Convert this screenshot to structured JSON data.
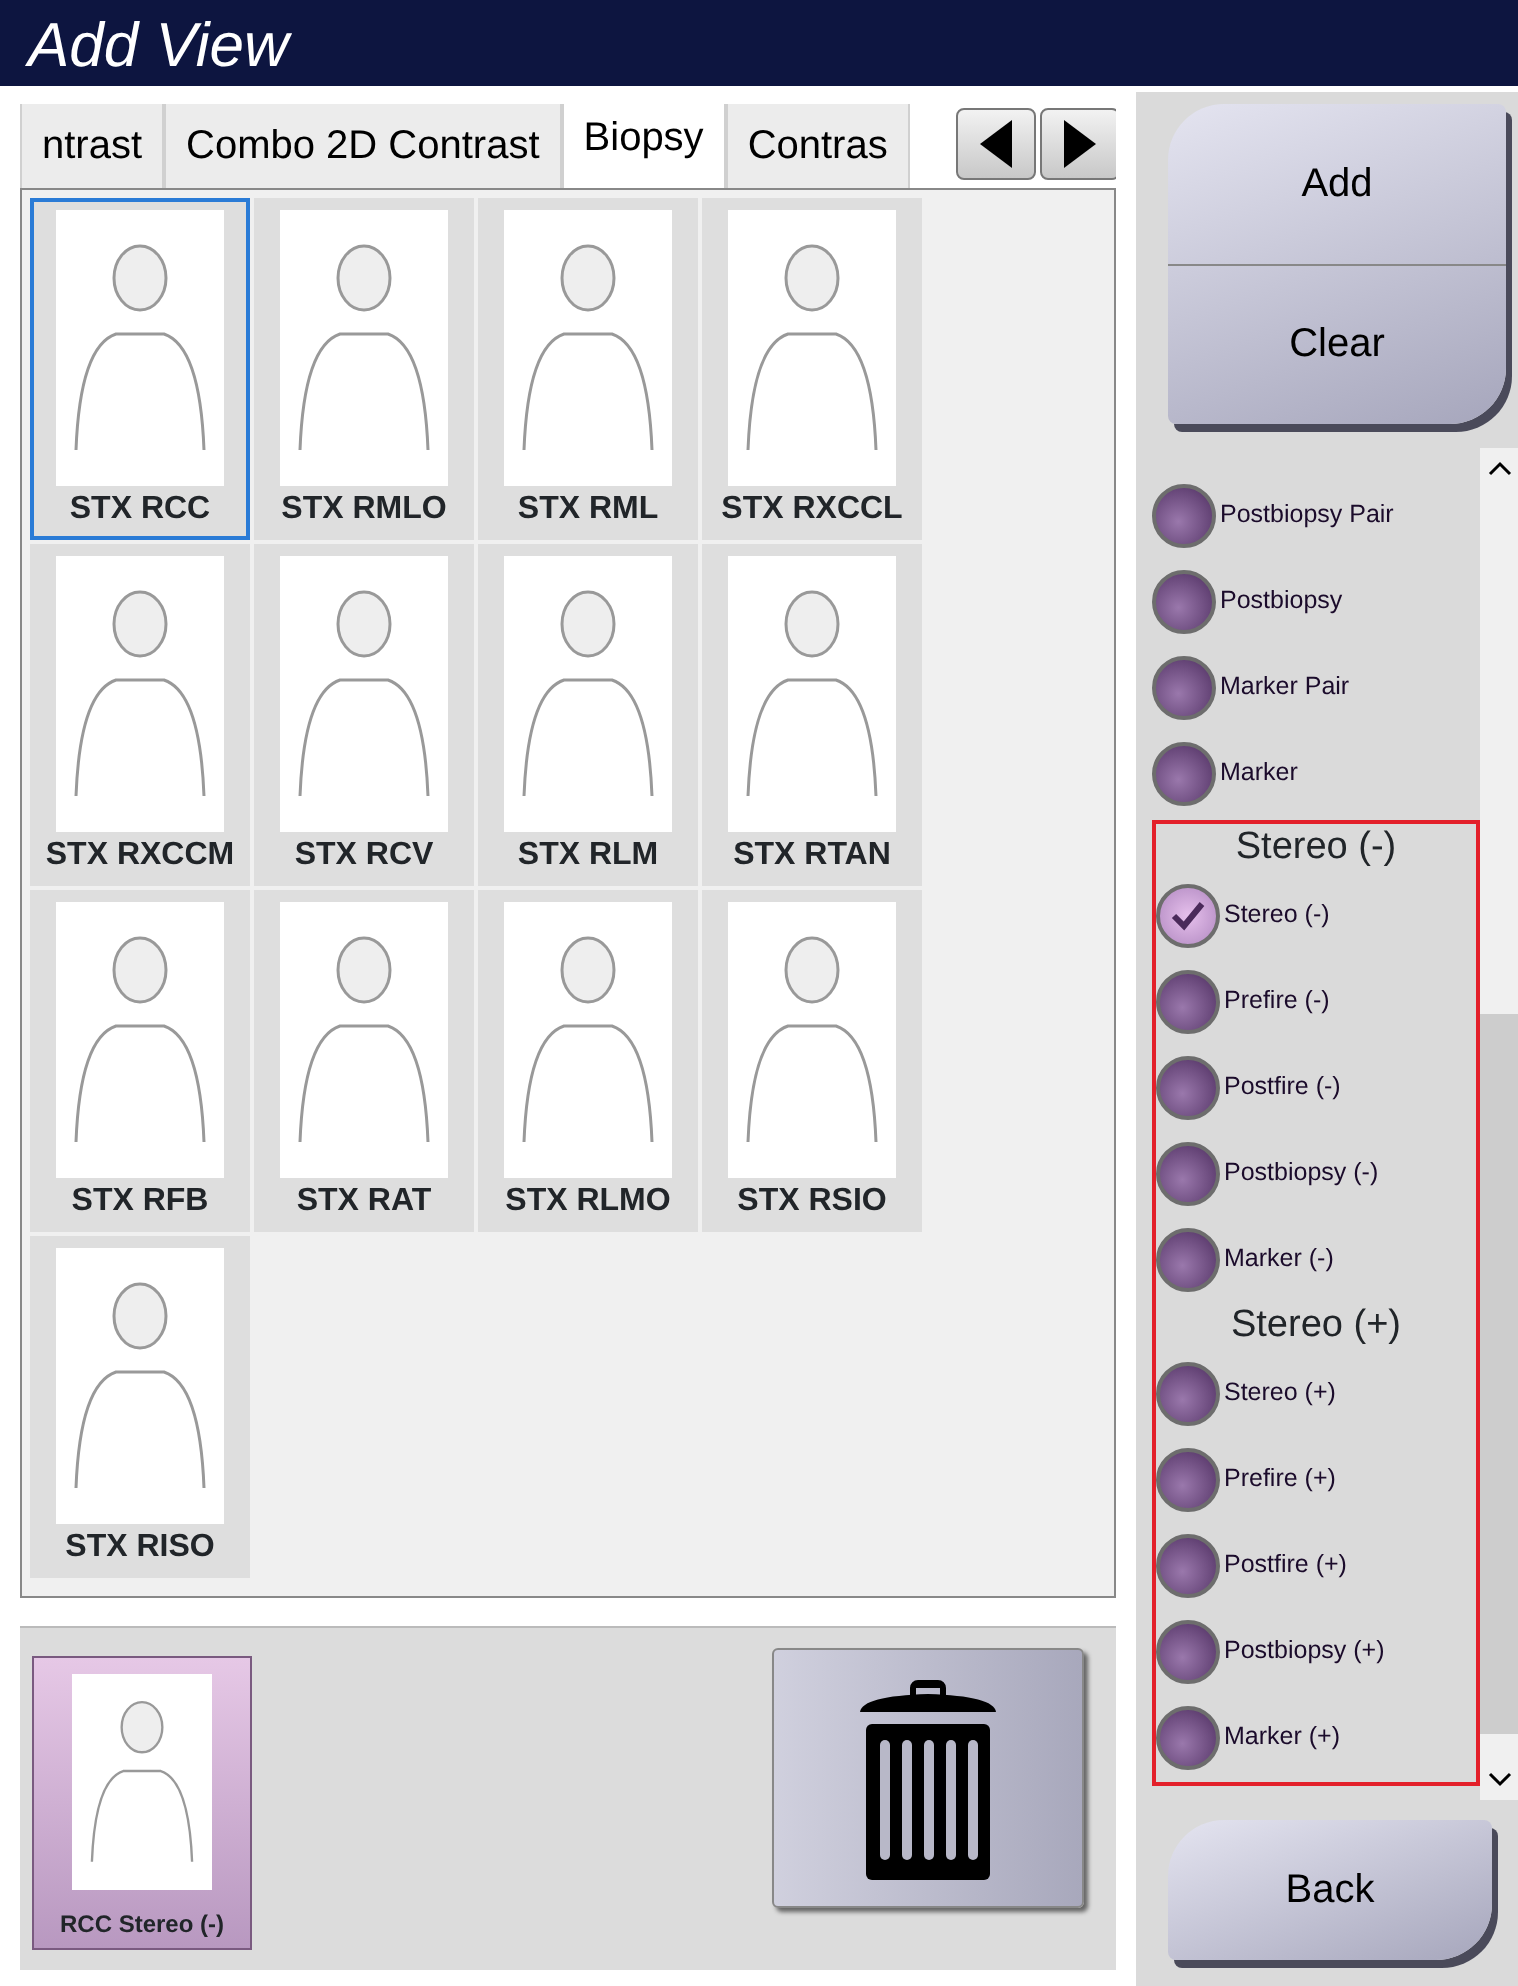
{
  "window": {
    "title": "Add View"
  },
  "tabs": [
    {
      "label": "ntrast",
      "selected": false
    },
    {
      "label": "Combo 2D Contrast",
      "selected": false
    },
    {
      "label": "Biopsy",
      "selected": true
    },
    {
      "label": "Contras",
      "selected": false
    }
  ],
  "views": [
    {
      "label": "STX RCC",
      "selected": true
    },
    {
      "label": "STX RMLO",
      "selected": false
    },
    {
      "label": "STX RML",
      "selected": false
    },
    {
      "label": "STX RXCCL",
      "selected": false
    },
    {
      "label": "STX RXCCM",
      "selected": false
    },
    {
      "label": "STX RCV",
      "selected": false
    },
    {
      "label": "STX RLM",
      "selected": false
    },
    {
      "label": "STX RTAN",
      "selected": false
    },
    {
      "label": "STX RFB",
      "selected": false
    },
    {
      "label": "STX RAT",
      "selected": false
    },
    {
      "label": "STX RLMO",
      "selected": false
    },
    {
      "label": "STX RSIO",
      "selected": false
    },
    {
      "label": "STX RISO",
      "selected": false
    }
  ],
  "tray": [
    {
      "label": "RCC Stereo (-)"
    }
  ],
  "buttons": {
    "add": "Add",
    "clear": "Clear",
    "back": "Back"
  },
  "options": [
    {
      "label": "Postbiopsy Pair",
      "checked": false
    },
    {
      "label": "Postbiopsy",
      "checked": false
    },
    {
      "label": "Marker Pair",
      "checked": false
    },
    {
      "label": "Marker",
      "checked": false
    }
  ],
  "highlighted_groups": [
    {
      "heading": "Stereo (-)",
      "items": [
        {
          "label": "Stereo (-)",
          "checked": true
        },
        {
          "label": "Prefire (-)",
          "checked": false
        },
        {
          "label": "Postfire (-)",
          "checked": false
        },
        {
          "label": "Postbiopsy (-)",
          "checked": false
        },
        {
          "label": "Marker (-)",
          "checked": false
        }
      ]
    },
    {
      "heading": "Stereo (+)",
      "items": [
        {
          "label": "Stereo (+)",
          "checked": false
        },
        {
          "label": "Prefire (+)",
          "checked": false
        },
        {
          "label": "Postfire (+)",
          "checked": false
        },
        {
          "label": "Postbiopsy (+)",
          "checked": false
        },
        {
          "label": "Marker (+)",
          "checked": false
        }
      ]
    }
  ]
}
